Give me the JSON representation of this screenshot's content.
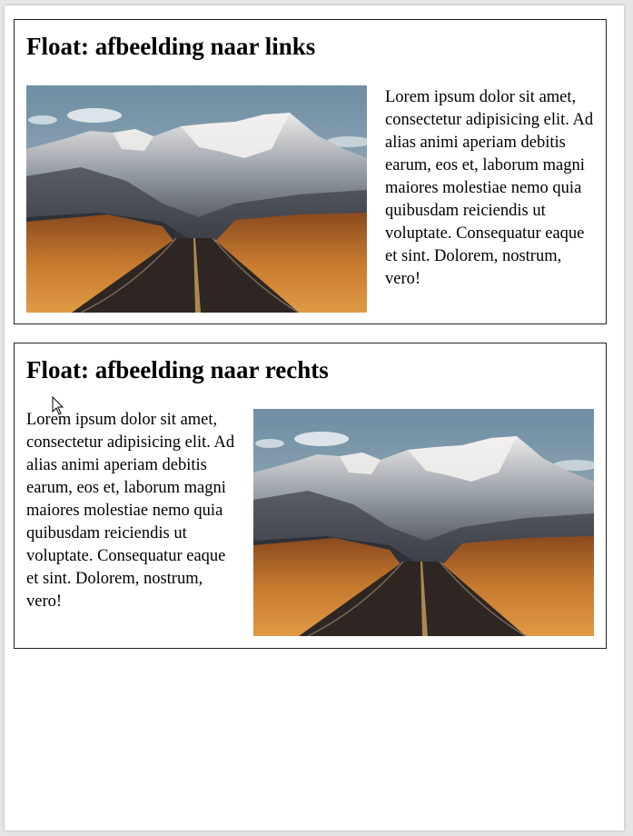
{
  "section_left": {
    "title": "Float: afbeelding naar links",
    "text": "Lorem ipsum dolor sit amet, consectetur adipisicing elit. Ad alias animi aperiam debitis earum, eos et, laborum magni maiores molestiae nemo quia quibusdam reiciendis ut voluptate. Consequatur eaque et sint. Dolorem, nostrum, vero!",
    "image": "mountain-road-photo"
  },
  "section_right": {
    "title": "Float: afbeelding naar rechts",
    "text": "Lorem ipsum dolor sit amet, consectetur adipisicing elit. Ad alias animi aperiam debitis earum, eos et, laborum magni maiores molestiae nemo quia quibusdam reiciendis ut voluptate. Consequatur eaque et sint. Dolorem, nostrum, vero!",
    "image": "mountain-road-photo"
  },
  "colors": {
    "border": "#222222",
    "sky": "#7f9fb3",
    "snow": "#e8e6e4",
    "rock": "#4a4d55",
    "shrub": "#c77a2e",
    "road": "#2e2622"
  }
}
